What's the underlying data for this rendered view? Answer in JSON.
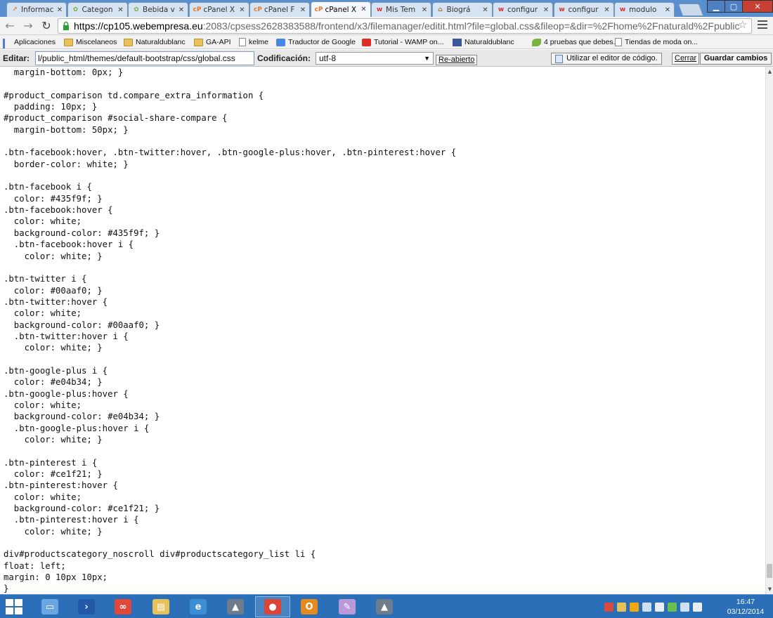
{
  "colors": {
    "tab_strip": "#5a8fcf",
    "close_button": "#c84031",
    "taskbar": "#2a6fb8",
    "active_tab": "#f4f7fb",
    "code_text": "#111111",
    "spellcheck_underline": "#ff0000"
  },
  "browser": {
    "tabs": [
      {
        "label": "Informac",
        "icon": "chart-icon",
        "color": "#e0853a",
        "active": false
      },
      {
        "label": "Categon",
        "icon": "leaf-icon",
        "color": "#7ab340",
        "active": false
      },
      {
        "label": "Bebida v",
        "icon": "leaf-icon",
        "color": "#7ab340",
        "active": false
      },
      {
        "label": "cPanel X",
        "icon": "cpanel-icon",
        "color": "#e87722",
        "active": false
      },
      {
        "label": "cPanel F",
        "icon": "cpanel-icon",
        "color": "#e87722",
        "active": false
      },
      {
        "label": "cPanel X",
        "icon": "cpanel-icon",
        "color": "#e87722",
        "active": true
      },
      {
        "label": "Mis Tem",
        "icon": "w-icon",
        "color": "#d6322e",
        "active": false
      },
      {
        "label": "Biográ",
        "icon": "hat-icon",
        "color": "#a0762e",
        "active": false
      },
      {
        "label": "configur",
        "icon": "w-icon",
        "color": "#d6322e",
        "active": false
      },
      {
        "label": "configur",
        "icon": "w-icon",
        "color": "#d6322e",
        "active": false
      },
      {
        "label": "modulo",
        "icon": "w-icon",
        "color": "#d6322e",
        "active": false
      }
    ],
    "url_host": "https://cp105.webempresa.eu",
    "url_rest": ":2083/cpsess2628383588/frontend/x3/filemanager/editit.html?file=global.css&fileop=&dir=%2Fhome%2Fnaturald%2Fpublic",
    "bookmarks": [
      {
        "label": "Aplicaciones",
        "icon": "apps-icon"
      },
      {
        "label": "Miscelaneos",
        "icon": "folder-icon"
      },
      {
        "label": "Naturaldublanc",
        "icon": "folder-icon"
      },
      {
        "label": "GA-API",
        "icon": "folder-icon"
      },
      {
        "label": "kelme",
        "icon": "page-icon"
      },
      {
        "label": "Traductor de Google",
        "icon": "translate-icon"
      },
      {
        "label": "Tutorial - WAMP on...",
        "icon": "youtube-icon"
      },
      {
        "label": "Naturaldublanc",
        "icon": "facebook-icon"
      },
      {
        "label": "4 pruebas que debes...",
        "icon": "leaf-icon"
      },
      {
        "label": "Tiendas de moda on...",
        "icon": "page-icon"
      }
    ]
  },
  "editor": {
    "edit_label": "Editar:",
    "file_path": "l/public_html/themes/default-bootstrap/css/global.css",
    "encoding_label": "Codificación:",
    "encoding_value": "utf-8",
    "reopen_label": "Re-abierto",
    "code_editor_label": "Utilizar el editor de código.",
    "close_label": "Cerrar",
    "save_label": "Guardar cambios",
    "code_lines": [
      "  margin-bottom: 0px; }",
      "",
      "#product_comparison td.compare_extra_information {",
      "  padding: 10px; }",
      "#product_comparison #social-share-compare {",
      "  margin-bottom: 50px; }",
      "",
      ".btn-facebook:hover, .btn-twitter:hover, .btn-google-plus:hover, .btn-pinterest:hover {",
      "  border-color: white; }",
      "",
      ".btn-facebook i {",
      "  color: #435f9f; }",
      ".btn-facebook:hover {",
      "  color: white;",
      "  background-color: #435f9f; }",
      "  .btn-facebook:hover i {",
      "    color: white; }",
      "",
      ".btn-twitter i {",
      "  color: #00aaf0; }",
      ".btn-twitter:hover {",
      "  color: white;",
      "  background-color: #00aaf0; }",
      "  .btn-twitter:hover i {",
      "    color: white; }",
      "",
      ".btn-google-plus i {",
      "  color: #e04b34; }",
      ".btn-google-plus:hover {",
      "  color: white;",
      "  background-color: #e04b34; }",
      "  .btn-google-plus:hover i {",
      "    color: white; }",
      "",
      ".btn-pinterest i {",
      "  color: #ce1f21; }",
      ".btn-pinterest:hover {",
      "  color: white;",
      "  background-color: #ce1f21; }",
      "  .btn-pinterest:hover i {",
      "    color: white; }",
      "",
      "div#productscategory_noscroll div#productscategory_list li {",
      "float: left;",
      "margin: 0 10px 10px;",
      "}"
    ]
  },
  "taskbar": {
    "apps": [
      {
        "name": "file-explorer-icon",
        "open": false
      },
      {
        "name": "powershell-icon",
        "open": false
      },
      {
        "name": "bridge-app-icon",
        "open": false
      },
      {
        "name": "folder-app-icon",
        "open": false
      },
      {
        "name": "internet-explorer-icon",
        "open": false
      },
      {
        "name": "rocket-app-icon",
        "open": false
      },
      {
        "name": "chrome-icon",
        "open": true
      },
      {
        "name": "outlook-icon",
        "open": false
      },
      {
        "name": "paint-icon",
        "open": false
      },
      {
        "name": "rocket-app-icon",
        "open": false
      }
    ],
    "time": "16:47",
    "date": "03/12/2014"
  }
}
